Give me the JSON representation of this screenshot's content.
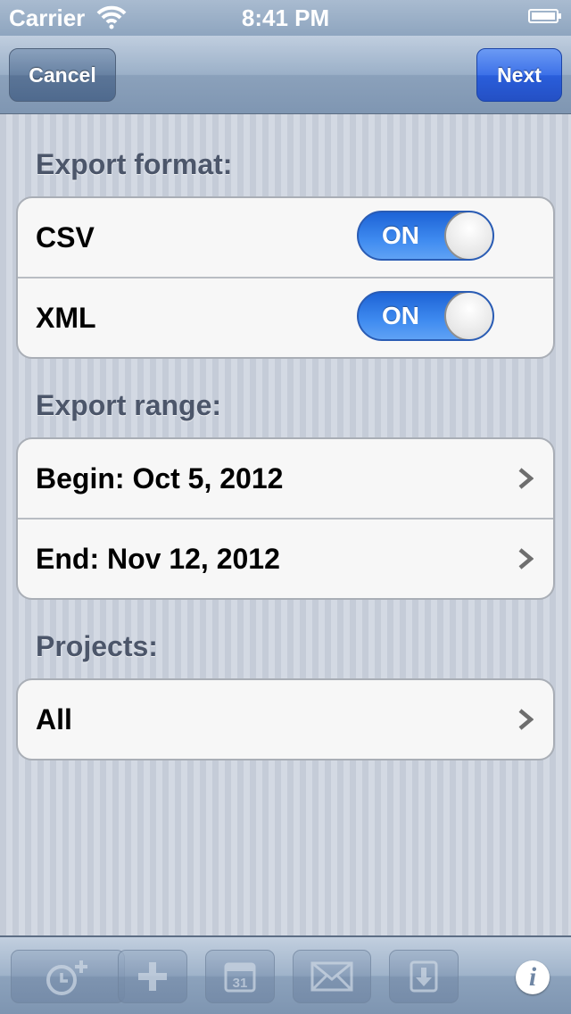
{
  "status_bar": {
    "carrier": "Carrier",
    "time": "8:41 PM"
  },
  "nav": {
    "cancel_label": "Cancel",
    "next_label": "Next"
  },
  "export_format": {
    "header": "Export format:",
    "options": [
      {
        "label": "CSV",
        "toggle_text": "ON",
        "on": true
      },
      {
        "label": "XML",
        "toggle_text": "ON",
        "on": true
      }
    ]
  },
  "export_range": {
    "header": "Export range:",
    "begin": "Begin: Oct 5, 2012",
    "end": "End: Nov 12, 2012"
  },
  "projects": {
    "header": "Projects:",
    "value": "All"
  },
  "toolbar": {
    "calendar_day": "31",
    "info_glyph": "i",
    "buttons": [
      "timer-add-icon",
      "plus-icon",
      "calendar-icon",
      "mail-icon",
      "download-icon"
    ]
  },
  "colors": {
    "toggle_on": "#3f8bf0",
    "next_button": "#2a5edb",
    "nav_bar": "#8ea5bf"
  }
}
